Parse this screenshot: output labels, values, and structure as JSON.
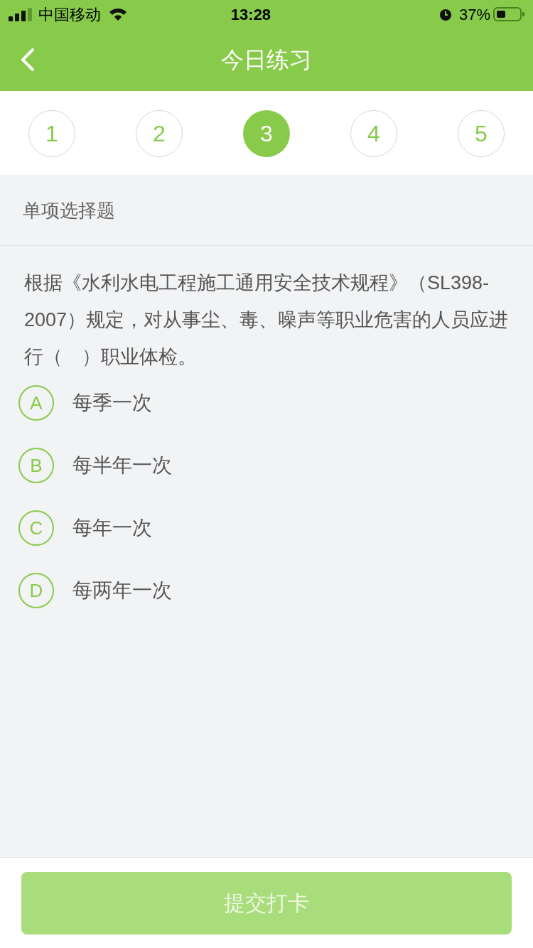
{
  "status_bar": {
    "carrier": "中国移动",
    "time": "13:28",
    "battery": "37%"
  },
  "nav": {
    "title": "今日练习"
  },
  "steps": [
    {
      "label": "1",
      "selected": false
    },
    {
      "label": "2",
      "selected": false
    },
    {
      "label": "3",
      "selected": true
    },
    {
      "label": "4",
      "selected": false
    },
    {
      "label": "5",
      "selected": false
    }
  ],
  "question": {
    "type": "单项选择题",
    "text": "根据《水利水电工程施工通用安全技术规程》（SL398-2007）规定，对从事尘、毒、噪声等职业危害的人员应进行（　）职业体检。",
    "options": [
      {
        "letter": "A",
        "text": "每季一次",
        "selected": false
      },
      {
        "letter": "B",
        "text": "每半年一次",
        "selected": false
      },
      {
        "letter": "C",
        "text": "每年一次",
        "selected": false
      },
      {
        "letter": "D",
        "text": "每两年一次",
        "selected": false
      }
    ]
  },
  "submit": {
    "label": "提交打卡",
    "disabled": true
  }
}
